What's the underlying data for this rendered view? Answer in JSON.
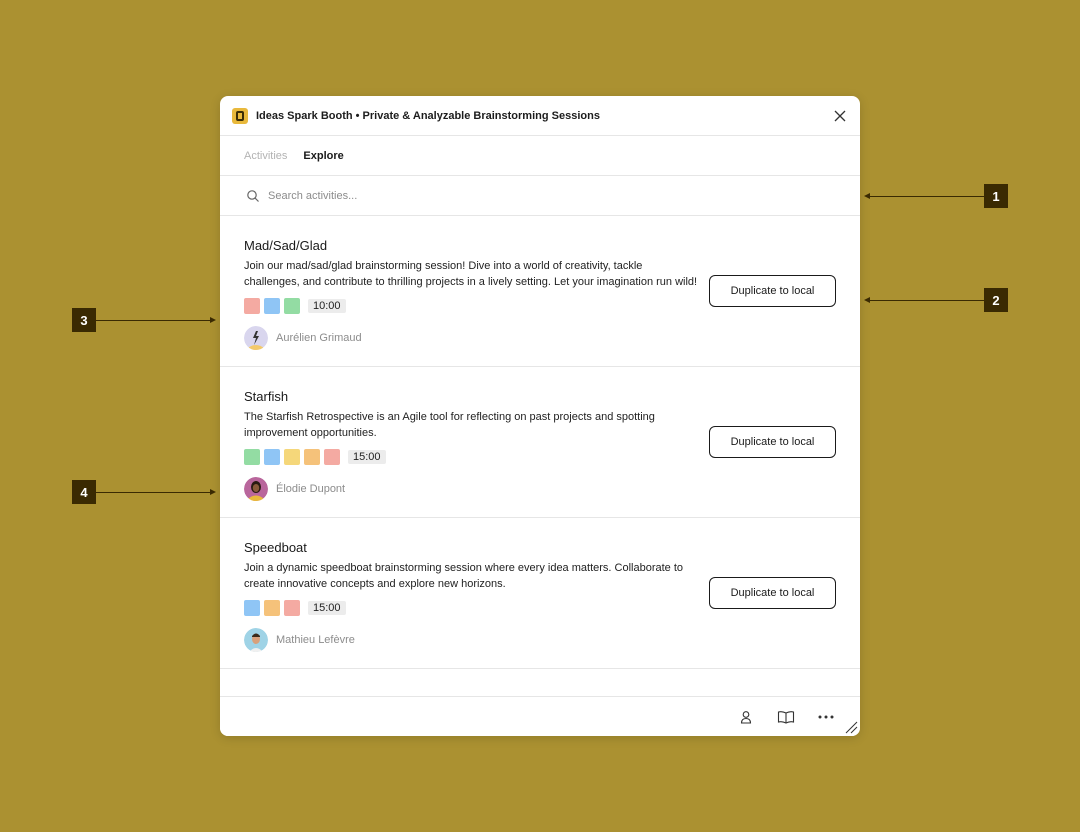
{
  "app": {
    "title": "Ideas Spark Booth • Private & Analyzable Brainstorming Sessions"
  },
  "tabs": [
    {
      "label": "Activities",
      "active": false
    },
    {
      "label": "Explore",
      "active": true
    }
  ],
  "search": {
    "placeholder": "Search activities...",
    "value": ""
  },
  "activities": [
    {
      "name": "Mad/Sad/Glad",
      "description": "Join our mad/sad/glad brainstorming session! Dive into a world of creativity, tackle challenges, and contribute to thrilling projects in a lively setting. Let your imagination run wild!",
      "colors": [
        "#f4aaa2",
        "#8fc5f5",
        "#93dca3"
      ],
      "duration": "10:00",
      "author": "Aurélien Grimaud",
      "button_label": "Duplicate to local"
    },
    {
      "name": "Starfish",
      "description": "The Starfish Retrospective is an Agile tool for reflecting on past projects and spotting improvement opportunities.",
      "colors": [
        "#93dca3",
        "#8fc5f5",
        "#f5d77a",
        "#f5c27a",
        "#f4aaa2"
      ],
      "duration": "15:00",
      "author": "Élodie Dupont",
      "button_label": "Duplicate to local"
    },
    {
      "name": "Speedboat",
      "description": "Join a dynamic speedboat brainstorming session where every idea matters. Collaborate to create innovative concepts and explore new horizons.",
      "colors": [
        "#8fc5f5",
        "#f5c27a",
        "#f4aaa2"
      ],
      "duration": "15:00",
      "author": "Mathieu Lefèvre",
      "button_label": "Duplicate to local"
    }
  ],
  "footer": {
    "icons": [
      "user-icon",
      "book-icon",
      "more-icon"
    ]
  },
  "callouts": [
    "1",
    "2",
    "3",
    "4"
  ],
  "theme": {
    "background": "#ab9131",
    "callout": "#3a2a02",
    "accent": "#e9b93c"
  }
}
